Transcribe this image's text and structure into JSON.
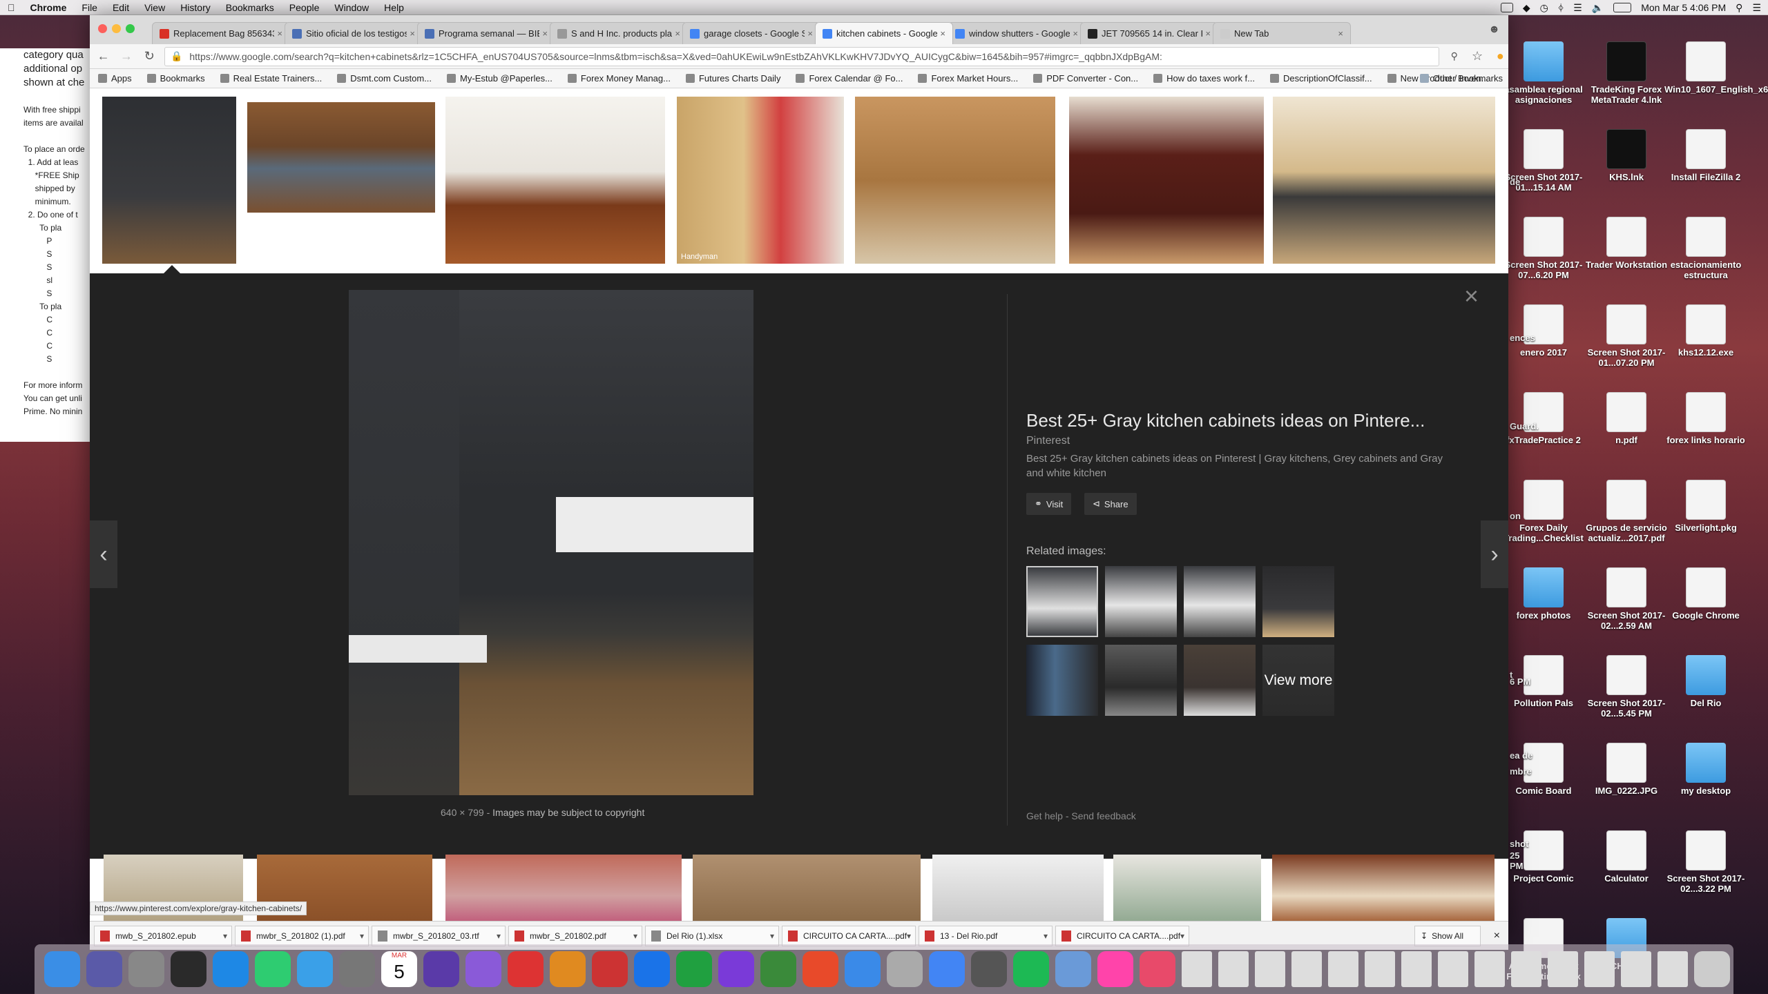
{
  "menubar": {
    "app": "Chrome",
    "items": [
      "File",
      "Edit",
      "View",
      "History",
      "Bookmarks",
      "People",
      "Window",
      "Help"
    ],
    "clock": "Mon Mar 5  4:06 PM"
  },
  "bgpage": {
    "lines": [
      "category qua",
      "additional op",
      "shown at che"
    ],
    "lines2": [
      "With free shippi",
      "items are availal",
      "",
      "To place an orde",
      "  1. Add at leas",
      "     *FREE Ship",
      "     shipped by",
      "     minimum.",
      "  2. Do one of t",
      "       To pla",
      "          P",
      "          S",
      "          S",
      "          sl",
      "          S",
      "       To pla",
      "          C",
      "          C",
      "          C",
      "          S",
      "",
      "For more inform",
      "You can get unli",
      "Prime. No minin"
    ]
  },
  "tabs": [
    {
      "label": "Replacement Bag 856343...",
      "color": "#d93025",
      "active": false
    },
    {
      "label": "Sitio oficial de los testigos...",
      "color": "#4a6fb5",
      "active": false
    },
    {
      "label": "Programa semanal — BIBL...",
      "color": "#4a6fb5",
      "active": false
    },
    {
      "label": "S and H Inc. products plast...",
      "color": "#999",
      "active": false
    },
    {
      "label": "garage closets - Google Se...",
      "color": "#4285f4",
      "active": false
    },
    {
      "label": "kitchen cabinets - Google S...",
      "color": "#4285f4",
      "active": true
    },
    {
      "label": "window shutters - Google S...",
      "color": "#4285f4",
      "active": false
    },
    {
      "label": "JET 709565 14 in. Clear Pla...",
      "color": "#222",
      "active": false
    },
    {
      "label": "New Tab",
      "color": "#ccc",
      "active": false
    }
  ],
  "toolbar": {
    "secure": "Secure",
    "url": "https://www.google.com/search?q=kitchen+cabinets&rlz=1C5CHFA_enUS704US705&source=lnms&tbm=isch&sa=X&ved=0ahUKEwiLw9nEstbZAhVKLKwKHV7JDvYQ_AUICygC&biw=1645&bih=957#imgrc=_qqbbnJXdpBgAM:"
  },
  "bookmarks": [
    "Apps",
    "Bookmarks",
    "Real Estate Trainers...",
    "Dsmt.com Custom...",
    "My-Estub @Paperles...",
    "Forex Money Manag...",
    "Futures Charts Daily",
    "Forex Calendar @ Fo...",
    "Forex Market Hours...",
    "PDF Converter - Con...",
    "How do taxes work f...",
    "DescriptionOfClassif...",
    "New Product / Inven..."
  ],
  "bookmarks_other": "Other Bookmarks",
  "preview": {
    "title": "Best 25+ Gray kitchen cabinets ideas on Pintere...",
    "source": "Pinterest",
    "description": "Best 25+ Gray kitchen cabinets ideas on Pinterest | Gray kitchens, Grey cabinets and Gray and white kitchen",
    "visit": "Visit",
    "share": "Share",
    "related_label": "Related images:",
    "view_more": "View more",
    "dimensions": "640 × 799",
    "copyright": "Images may be subject to copyright",
    "get_help": "Get help",
    "send_feedback": "Send feedback",
    "watermark": "Handyman"
  },
  "status_url": "https://www.pinterest.com/explore/gray-kitchen-cabinets/",
  "downloads": [
    {
      "name": "mwb_S_201802.epub",
      "color": "#c33"
    },
    {
      "name": "mwbr_S_201802 (1).pdf",
      "color": "#c33"
    },
    {
      "name": "mwbr_S_201802_03.rtf",
      "color": "#888"
    },
    {
      "name": "mwbr_S_201802.pdf",
      "color": "#c33"
    },
    {
      "name": "Del Rio (1).xlsx",
      "color": "#888"
    },
    {
      "name": "CIRCUITO CA    CARTA....pdf",
      "color": "#c33"
    },
    {
      "name": "13 - Del Rio.pdf",
      "color": "#c33"
    },
    {
      "name": "CIRCUITO CA    CARTA....pdf",
      "color": "#c33"
    }
  ],
  "show_all": "Show All",
  "desktop_icons": [
    {
      "label": "asamblea regional asignaciones",
      "type": "folder"
    },
    {
      "label": "TradeKing Forex MetaTrader 4.lnk",
      "type": "term"
    },
    {
      "label": "Win10_1607_English_x64.iso",
      "type": "doc"
    },
    {
      "label": "Screen Shot 2017-01...15.14 AM",
      "type": "doc"
    },
    {
      "label": "KHS.lnk",
      "type": "term"
    },
    {
      "label": "Install FileZilla 2",
      "type": "doc"
    },
    {
      "label": "Screen Shot 2017-07...6.20 PM",
      "type": "doc"
    },
    {
      "label": "Trader Workstation",
      "type": "doc"
    },
    {
      "label": "estacionamiento estructura",
      "type": "doc"
    },
    {
      "label": "enero 2017",
      "type": "doc"
    },
    {
      "label": "Screen Shot 2017-01...07.20 PM",
      "type": "doc"
    },
    {
      "label": "khs12.12.exe",
      "type": "doc"
    },
    {
      "label": "fxTradePractice 2",
      "type": "doc"
    },
    {
      "label": "n.pdf",
      "type": "doc"
    },
    {
      "label": "forex links horario",
      "type": "doc"
    },
    {
      "label": "Forex Daily Trading...Checklist",
      "type": "doc"
    },
    {
      "label": "Grupos de servicio actualiz...2017.pdf",
      "type": "doc"
    },
    {
      "label": "Silverlight.pkg",
      "type": "doc"
    },
    {
      "label": "forex photos",
      "type": "folder"
    },
    {
      "label": "Screen Shot 2017-02...2.59 AM",
      "type": "doc"
    },
    {
      "label": "Google Chrome",
      "type": "doc"
    },
    {
      "label": "Pollution Pals",
      "type": "doc"
    },
    {
      "label": "Screen Shot 2017-02...5.45 PM",
      "type": "doc"
    },
    {
      "label": "Del Rio",
      "type": "folder"
    },
    {
      "label": "Comic Board",
      "type": "doc"
    },
    {
      "label": "IMG_0222.JPG",
      "type": "doc"
    },
    {
      "label": "my desktop",
      "type": "folder"
    },
    {
      "label": "Project Comic",
      "type": "doc"
    },
    {
      "label": "Calculator",
      "type": "doc"
    },
    {
      "label": "Screen Shot 2017-02...3.22 PM",
      "type": "doc"
    },
    {
      "label": "Assignment List For Meeting.docx",
      "type": "doc"
    },
    {
      "label": "SCHOOLV",
      "type": "folder"
    }
  ],
  "desktop_partial": [
    "de",
    "ences",
    "Guard.",
    "on",
    "t",
    "6 PM",
    "ea de",
    "mbre",
    "shot",
    "25 PM"
  ],
  "dock_calendar": {
    "month": "MAR",
    "day": "5"
  }
}
